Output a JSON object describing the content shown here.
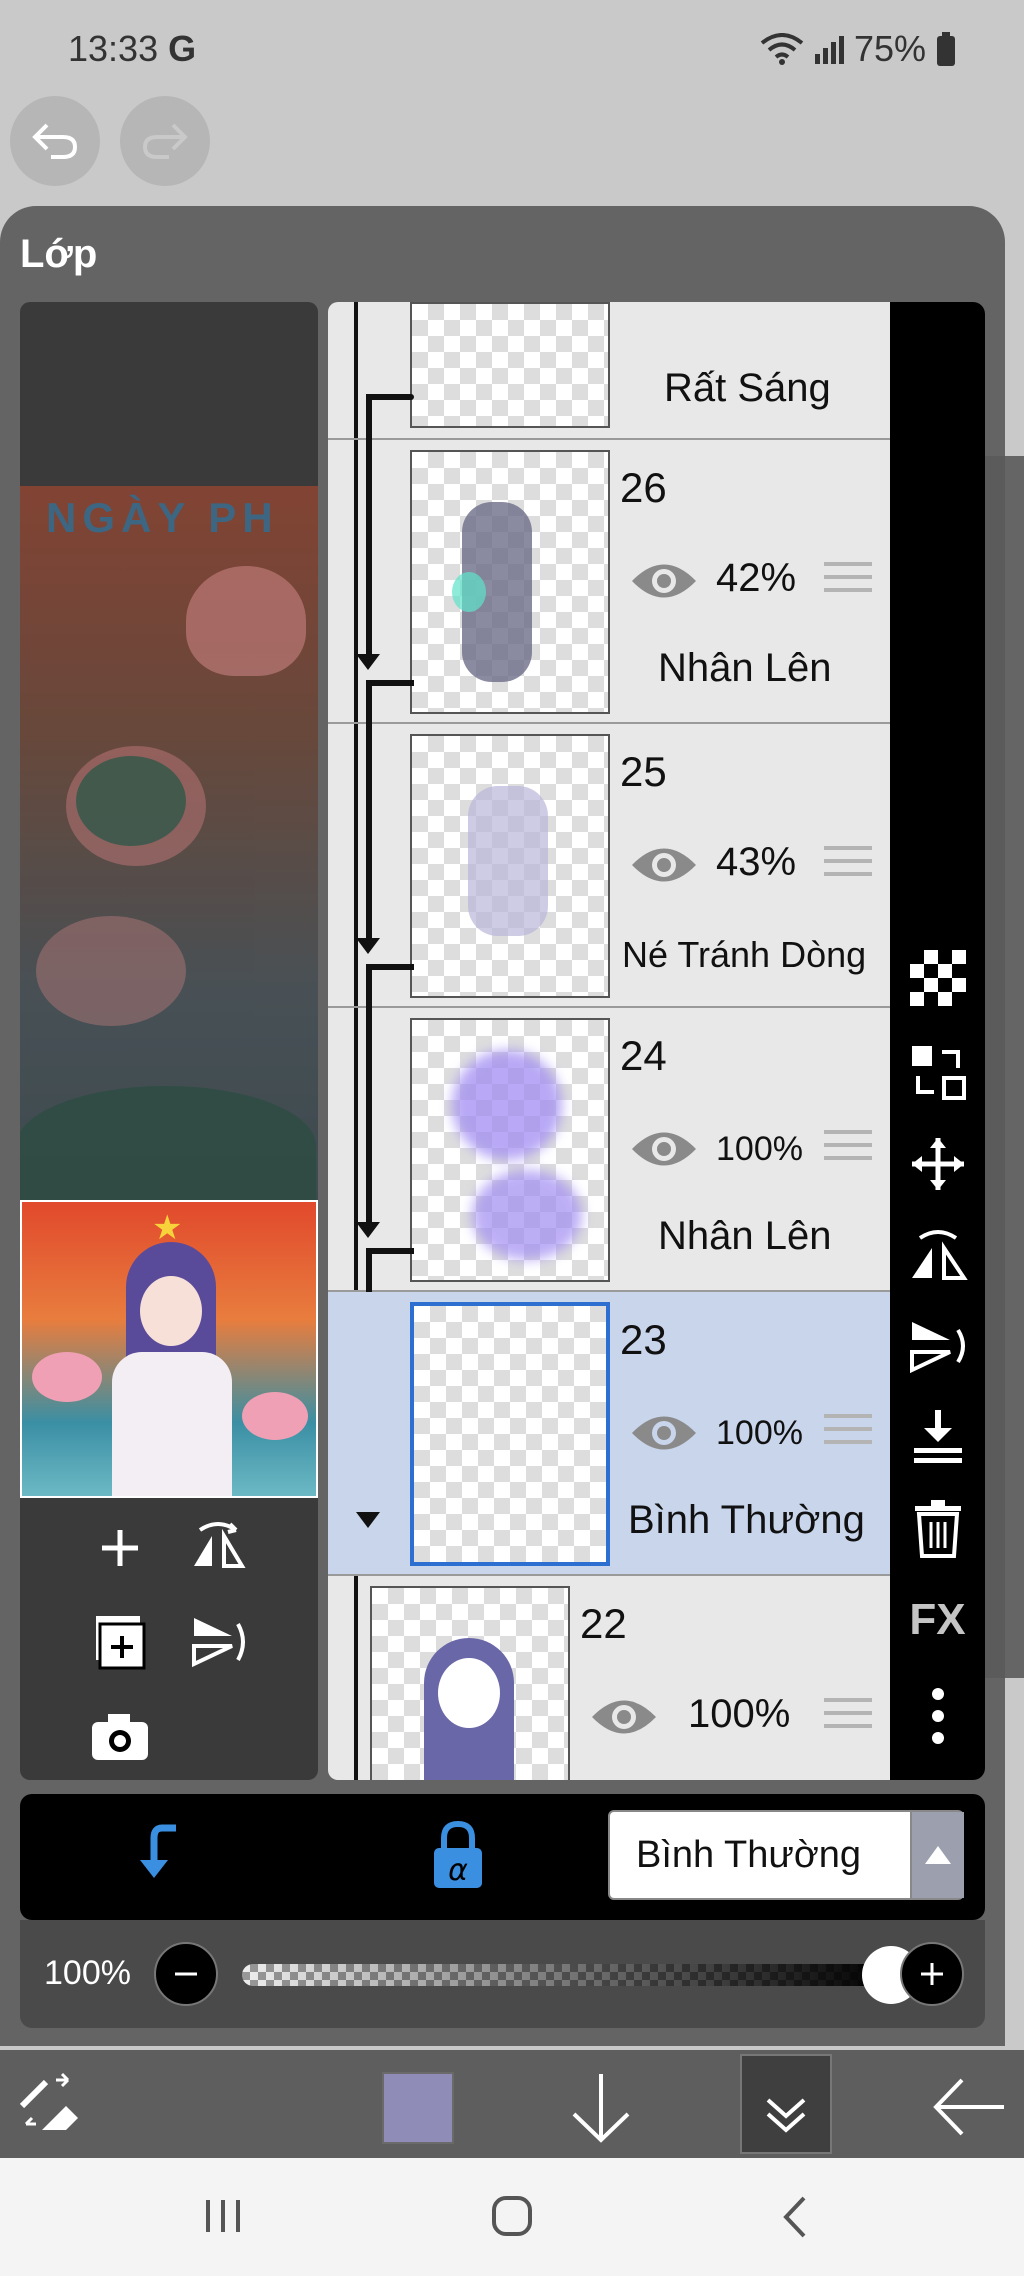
{
  "status_bar": {
    "time": "13:33",
    "g_icon": "G",
    "battery": "75%"
  },
  "panel": {
    "title": "Lớp"
  },
  "preview": {
    "banner_text": "NGÀY PH"
  },
  "layers": [
    {
      "number": "",
      "opacity": "",
      "blend": "Rất Sáng",
      "partial": true
    },
    {
      "number": "26",
      "opacity": "42%",
      "blend": "Nhân Lên"
    },
    {
      "number": "25",
      "opacity": "43%",
      "blend": "Né Tránh Dòng"
    },
    {
      "number": "24",
      "opacity": "100%",
      "blend": "Nhân Lên"
    },
    {
      "number": "23",
      "opacity": "100%",
      "blend": "Bình Thường",
      "selected": true
    },
    {
      "number": "22",
      "opacity": "100%",
      "blend": ""
    }
  ],
  "side_tools": [
    "checker-icon",
    "swap-layer-icon",
    "move-icon",
    "flip-horizontal-icon",
    "flip-vertical-icon",
    "merge-down-icon",
    "trash-icon",
    "fx-icon",
    "more-icon"
  ],
  "fx_label": "FX",
  "blend_mode": {
    "value": "Bình Thường"
  },
  "opacity": {
    "label": "100%",
    "value": 100
  },
  "colors": {
    "current_color": "#8f8db7",
    "selected_blue": "#2d6fd0",
    "accent_blue": "#3a8fe0"
  }
}
